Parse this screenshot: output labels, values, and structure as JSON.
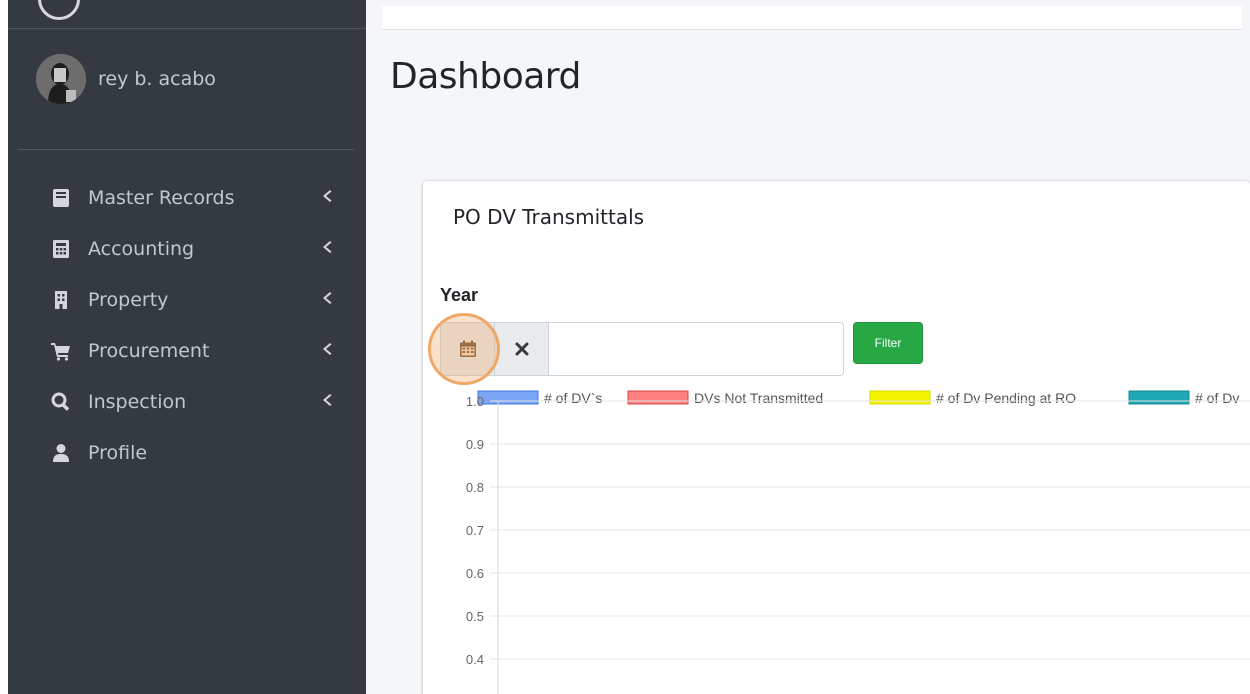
{
  "user": {
    "name": "rey b. acabo"
  },
  "sidebar": {
    "items": [
      {
        "label": "Master Records",
        "icon": "book-icon",
        "has_children": true
      },
      {
        "label": "Accounting",
        "icon": "calculator-icon",
        "has_children": true
      },
      {
        "label": "Property",
        "icon": "building-icon",
        "has_children": true
      },
      {
        "label": "Procurement",
        "icon": "cart-icon",
        "has_children": true
      },
      {
        "label": "Inspection",
        "icon": "search-icon",
        "has_children": true
      },
      {
        "label": "Profile",
        "icon": "user-icon",
        "has_children": false
      }
    ]
  },
  "page": {
    "title": "Dashboard"
  },
  "card": {
    "title": "PO DV Transmittals",
    "year_label": "Year",
    "year_value": "",
    "filter_label": "Filter"
  },
  "colors": {
    "sidebar_bg": "#343a40",
    "filter_btn": "#28a745",
    "highlight": "#f0a868"
  },
  "chart_data": {
    "type": "bar",
    "series": [
      {
        "name": "# of DV`s",
        "color": "#7aa6f5",
        "border": "#3e74e0",
        "values": []
      },
      {
        "name": "DVs Not Transmitted",
        "color": "#ff8080",
        "border": "#d64545",
        "values": []
      },
      {
        "name": "# of Dv Pending at RO",
        "color": "#f5f500",
        "border": "#d8d800",
        "values": []
      },
      {
        "name": "# of Dv",
        "color": "#1fa7b3",
        "border": "#198a94",
        "values": []
      }
    ],
    "yticks": [
      "1.0",
      "0.9",
      "0.8",
      "0.7",
      "0.6",
      "0.5",
      "0.4"
    ],
    "ylim": [
      0,
      1
    ],
    "grid": true,
    "legend": "top"
  }
}
